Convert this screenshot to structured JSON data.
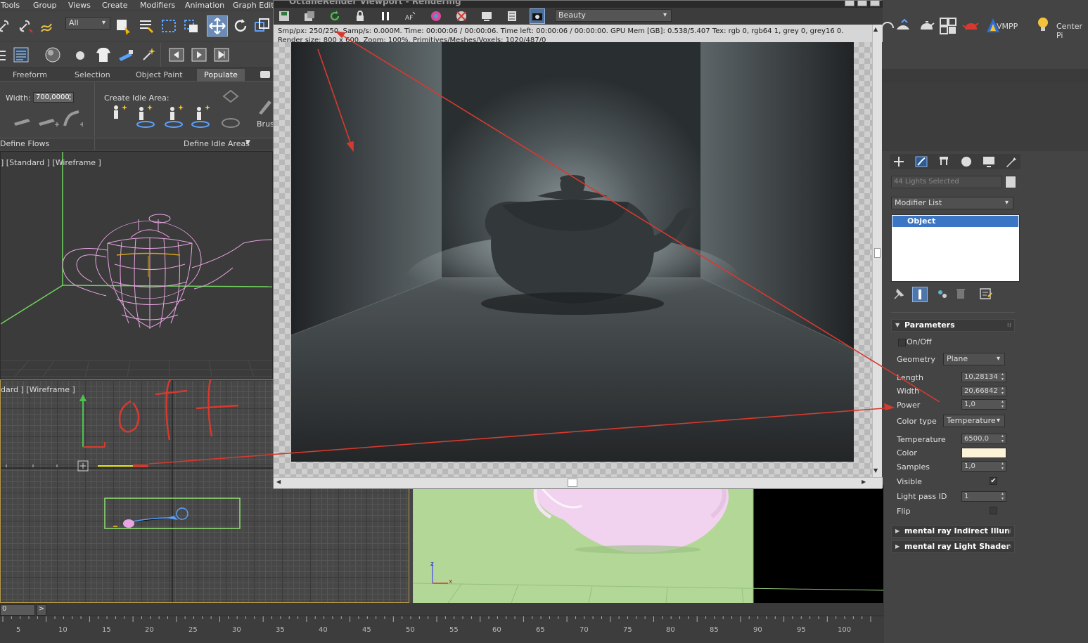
{
  "menubar": {
    "items": [
      "Tools",
      "Group",
      "Views",
      "Create",
      "Modifiers",
      "Animation",
      "Graph Edito"
    ]
  },
  "main_toolbar": {
    "selection_filter": "All"
  },
  "ribbon": {
    "tabs": [
      "Freeform",
      "Selection",
      "Object Paint",
      "Populate"
    ],
    "active_tab": "Populate",
    "width_label": "Width:",
    "width_value": "700,0000",
    "create_idle_area_label": "Create Idle Area:",
    "brush_label": "Brus",
    "define_flows_label": "Define Flows",
    "define_idle_areas_label": "Define Idle Areas"
  },
  "viewports": {
    "top_left_label": "] [Standard ] [Wireframe ]",
    "bottom_left_label": "dard ] [Wireframe ]",
    "annotation_text": "off",
    "axis_x": "x",
    "axis_z": "z"
  },
  "octane": {
    "title": "OctaneRender Viewport - Rendering",
    "pass_dropdown": "Beauty",
    "stats_line1": "Smp/px: 250/250.   Samp/s: 0.000M.   Time: 00:00:06 / 00:00:06.   Time left: 00:00:06 / 00:00:00.   GPU Mem [GB]: 0.538/5.407   Tex: rgb 0, rgb64 1, grey 0, grey16 0.",
    "stats_line2": "Render size: 800 x 600.   Zoom: 100%.   Primitives/Meshes/Voxels: 1020/487/0"
  },
  "top_right_toolbar": {
    "vmpp_label": "VMPP",
    "center_label": "Center Pi"
  },
  "command_panel": {
    "selection_name": "44 Lights Selected",
    "modifier_list": "Modifier List",
    "stack_item": "Object",
    "rollouts": {
      "parameters": "Parameters",
      "mr_indirect": "mental ray Indirect Illun",
      "mr_shader": "mental ray Light Shader"
    },
    "params": {
      "onoff_label": "On/Off",
      "onoff_checked": false,
      "geometry_label": "Geometry",
      "geometry_value": "Plane",
      "length_label": "Length",
      "length_value": "10,28134",
      "width_label": "Width",
      "width_value": "20,66842",
      "power_label": "Power",
      "power_value": "1,0",
      "color_type_label": "Color type",
      "color_type_value": "Temperature",
      "temperature_label": "Temperature",
      "temperature_value": "6500,0",
      "color_label": "Color",
      "color_swatch": "#fdf3d8",
      "samples_label": "Samples",
      "samples_value": "1,0",
      "visible_label": "Visible",
      "visible_checked": "✔",
      "light_pass_label": "Light pass ID",
      "light_pass_value": "1",
      "flip_label": "Flip"
    }
  },
  "timeline": {
    "frame_field": "0",
    "next_button": ">"
  },
  "ruler": {
    "ticks": [
      "5",
      "10",
      "15",
      "20",
      "25",
      "30",
      "35",
      "40",
      "45",
      "50",
      "55",
      "60",
      "65",
      "70",
      "75",
      "80",
      "85",
      "90",
      "95",
      "100"
    ]
  },
  "colors": {
    "annotation_red": "#d63a2f",
    "wire_pink": "#e9a5e3",
    "accent_blue": "#2d5b96",
    "stack_highlight": "#3a76c4"
  }
}
